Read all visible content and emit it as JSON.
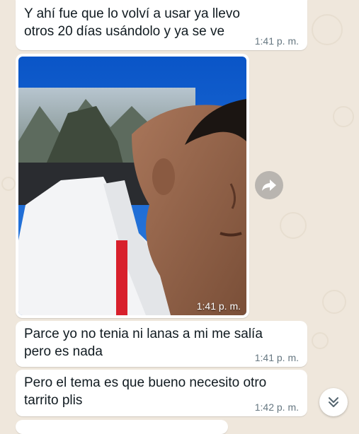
{
  "messages": [
    {
      "text": "Y ahí fue que lo volví a usar ya llevo otros 20 días usándolo y ya se ve",
      "time": "1:41 p. m."
    },
    {
      "time": "1:41 p. m."
    },
    {
      "text": "Parce yo no tenia ni lanas a mi me salía pero es nada",
      "time": "1:41 p. m."
    },
    {
      "text": "Pero el tema es que bueno necesito otro tarrito plis",
      "time": "1:42 p. m."
    }
  ],
  "icons": {
    "forward": "forward-arrow-icon",
    "scroll_down": "double-chevron-down-icon"
  },
  "colors": {
    "chat_background": "#efe7dc",
    "bubble_background": "#ffffff",
    "text": "#111b21",
    "timestamp": "#667781"
  }
}
